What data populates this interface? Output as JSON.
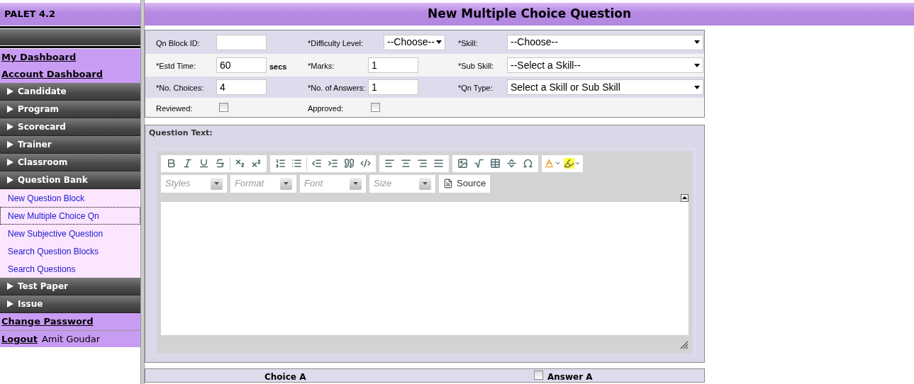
{
  "app_title": "PALET 4.2",
  "sidebar": {
    "items": [
      {
        "kind": "link",
        "label": "My Dashboard"
      },
      {
        "kind": "link",
        "label": "Account Dashboard"
      },
      {
        "kind": "section",
        "label": "Candidate"
      },
      {
        "kind": "section",
        "label": "Program"
      },
      {
        "kind": "section",
        "label": "Scorecard"
      },
      {
        "kind": "section",
        "label": "Trainer"
      },
      {
        "kind": "section",
        "label": "Classroom"
      },
      {
        "kind": "section",
        "label": "Question Bank",
        "children": [
          {
            "label": "New Question Block",
            "selected": false
          },
          {
            "label": "New Multiple Choice Qn",
            "selected": true
          },
          {
            "label": "New Subjective Question",
            "selected": false
          },
          {
            "label": "Search Question Blocks",
            "selected": false
          },
          {
            "label": "Search Questions",
            "selected": false
          }
        ]
      },
      {
        "kind": "section",
        "label": "Test Paper"
      },
      {
        "kind": "section",
        "label": "Issue"
      },
      {
        "kind": "link",
        "label": "Change Password"
      },
      {
        "kind": "logout",
        "label": "Logout",
        "user": "Amit Goudar"
      }
    ]
  },
  "page_title": "New Multiple Choice Question",
  "form": {
    "rows": [
      [
        {
          "kind": "text",
          "label": "Qn Block ID:"
        },
        {
          "kind": "select",
          "label": "*Difficulty Level:",
          "value": "--Choose--"
        },
        {
          "kind": "wideselect",
          "label": "*Skill:",
          "value": "--Choose--"
        }
      ],
      [
        {
          "kind": "text",
          "label": "*Estd Time:",
          "value": "60",
          "suffix": "secs"
        },
        {
          "kind": "text",
          "label": "*Marks:",
          "value": "1"
        },
        {
          "kind": "wideselect",
          "label": "*Sub Skill:",
          "value": "--Select a Skill--"
        }
      ],
      [
        {
          "kind": "text",
          "label": "*No. Choices:",
          "value": "4"
        },
        {
          "kind": "text",
          "label": "*No. of Answers:",
          "value": "1"
        },
        {
          "kind": "wideselect",
          "label": "*Qn Type:",
          "value": "Select a Skill or Sub Skill"
        }
      ],
      [
        {
          "kind": "checkbox",
          "label": "Reviewed:",
          "checked": false
        },
        {
          "kind": "checkbox",
          "label": "Approved:",
          "checked": false
        }
      ]
    ]
  },
  "question_text": {
    "label": "Question Text:",
    "combos": [
      {
        "placeholder": "Styles"
      },
      {
        "placeholder": "Format"
      },
      {
        "placeholder": "Font"
      },
      {
        "placeholder": "Size"
      }
    ],
    "source_button": "Source"
  },
  "choice": {
    "label": "Choice A",
    "answer_label": "Answer A",
    "answer_checked": false
  }
}
